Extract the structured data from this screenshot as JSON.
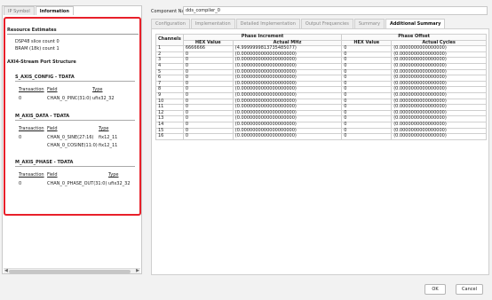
{
  "left_tabs": [
    "IP Symbol",
    "Information"
  ],
  "left_active_tab": 1,
  "resource": {
    "title": "Resource Estimates",
    "items": [
      "DSP48 slice count 0",
      "BRAM (18k) count 1"
    ]
  },
  "axi": {
    "title": "AXI4-Stream Port Structure",
    "config": {
      "title": "S_AXIS_CONFIG - TDATA",
      "headers": [
        "Transaction",
        "Field",
        "Type"
      ],
      "rows": [
        [
          "0",
          "CHAN_0_PINC(31:0)",
          "ufix32_32"
        ]
      ]
    },
    "data": {
      "title": "M_AXIS_DATA - TDATA",
      "headers": [
        "Transaction",
        "Field",
        "Type"
      ],
      "rows": [
        [
          "0",
          "CHAN_0_SINE(27:16)",
          "fix12_11"
        ],
        [
          "",
          "CHAN_0_COSINE(11:0)",
          "fix12_11"
        ]
      ]
    },
    "phase": {
      "title": "M_AXIS_PHASE - TDATA",
      "headers": [
        "Transaction",
        "Field",
        "Type"
      ],
      "rows": [
        [
          "0",
          "CHAN_0_PHASE_OUT(31:0)",
          "ufix32_32"
        ]
      ]
    }
  },
  "component_name": {
    "label": "Component Name",
    "value": "dds_compiler_0"
  },
  "right_tabs": [
    "Configuration",
    "Implementation",
    "Detailed Implementation",
    "Output Frequencies",
    "Summary",
    "Additional Summary"
  ],
  "right_active_tab": 5,
  "table": {
    "col_channels": "Channels",
    "group_inc": "Phase Increment",
    "group_off": "Phase Offset",
    "sub_headers": [
      "HEX Value",
      "Actual MHz",
      "HEX Value",
      "Actual Cycles"
    ],
    "rows": [
      [
        "1",
        "6666666",
        "(4.9999999813735485077)",
        "0",
        "(0.0000000000000000)"
      ],
      [
        "2",
        "0",
        "(0.0000000000000000000)",
        "0",
        "(0.0000000000000000)"
      ],
      [
        "3",
        "0",
        "(0.0000000000000000000)",
        "0",
        "(0.0000000000000000)"
      ],
      [
        "4",
        "0",
        "(0.0000000000000000000)",
        "0",
        "(0.0000000000000000)"
      ],
      [
        "5",
        "0",
        "(0.0000000000000000000)",
        "0",
        "(0.0000000000000000)"
      ],
      [
        "6",
        "0",
        "(0.0000000000000000000)",
        "0",
        "(0.0000000000000000)"
      ],
      [
        "7",
        "0",
        "(0.0000000000000000000)",
        "0",
        "(0.0000000000000000)"
      ],
      [
        "8",
        "0",
        "(0.0000000000000000000)",
        "0",
        "(0.0000000000000000)"
      ],
      [
        "9",
        "0",
        "(0.0000000000000000000)",
        "0",
        "(0.0000000000000000)"
      ],
      [
        "10",
        "0",
        "(0.0000000000000000000)",
        "0",
        "(0.0000000000000000)"
      ],
      [
        "11",
        "0",
        "(0.0000000000000000000)",
        "0",
        "(0.0000000000000000)"
      ],
      [
        "12",
        "0",
        "(0.0000000000000000000)",
        "0",
        "(0.0000000000000000)"
      ],
      [
        "13",
        "0",
        "(0.0000000000000000000)",
        "0",
        "(0.0000000000000000)"
      ],
      [
        "14",
        "0",
        "(0.0000000000000000000)",
        "0",
        "(0.0000000000000000)"
      ],
      [
        "15",
        "0",
        "(0.0000000000000000000)",
        "0",
        "(0.0000000000000000)"
      ],
      [
        "16",
        "0",
        "(0.0000000000000000000)",
        "0",
        "(0.0000000000000000)"
      ]
    ]
  },
  "buttons": {
    "ok": "OK",
    "cancel": "Cancel"
  },
  "colors": {
    "highlight": "#e8202a"
  }
}
